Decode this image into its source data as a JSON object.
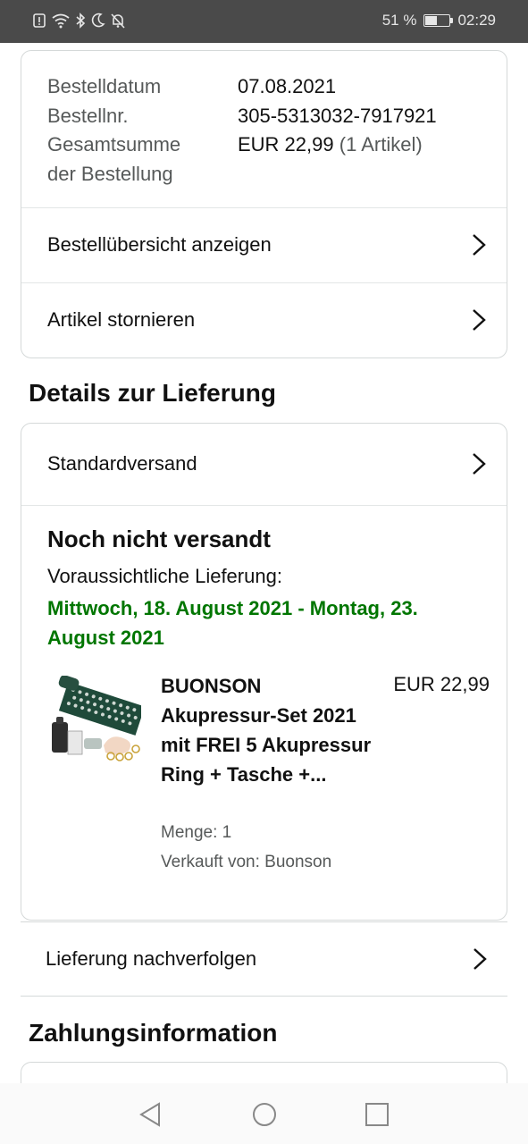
{
  "status_bar": {
    "battery_text": "51 %",
    "battery_level": 0.51,
    "time": "02:29",
    "icons": [
      "alert-icon",
      "wifi-icon",
      "bluetooth-icon",
      "moon-icon",
      "bell-off-icon"
    ]
  },
  "order_summary": {
    "rows": [
      {
        "label": "Bestelldatum",
        "value": "07.08.2021",
        "extra": ""
      },
      {
        "label": "Bestellnr.",
        "value": "305-5313032-7917921",
        "extra": ""
      },
      {
        "label": "Gesamtsumme",
        "value": "EUR 22,99",
        "extra": "(1 Artikel)"
      },
      {
        "label": "der Bestellung",
        "value": "",
        "extra": ""
      }
    ],
    "view_order_label": "Bestellübersicht anzeigen",
    "cancel_label": "Artikel stornieren"
  },
  "delivery": {
    "section_title": "Details zur Lieferung",
    "shipping_method": "Standardversand",
    "status": "Noch nicht versandt",
    "eta_label": "Voraussichtliche Lieferung:",
    "eta_date": "Mittwoch, 18. August 2021 - Montag, 23. August 2021",
    "accent_color": "#007600",
    "item": {
      "title": "BUONSON Akupressur-Set 2021 mit FREI 5 Akupressur Ring + Tasche +...",
      "price": "EUR 22,99",
      "quantity": "Menge: 1",
      "seller": "Verkauft von: Buonson"
    },
    "track_label": "Lieferung nachverfolgen"
  },
  "payment": {
    "section_title": "Zahlungsinformation"
  },
  "nav": {
    "buttons": [
      "back-icon",
      "home-icon",
      "recents-icon"
    ]
  }
}
